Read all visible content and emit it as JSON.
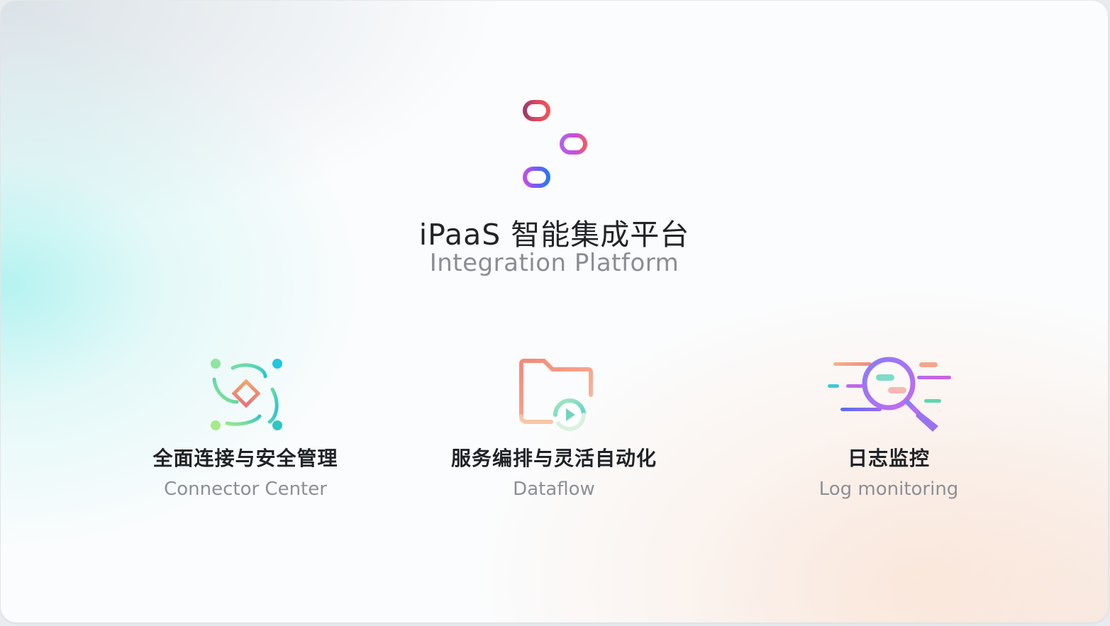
{
  "hero": {
    "title": "iPaaS 智能集成平台",
    "subtitle": "Integration Platform",
    "icon": "sliders-icon"
  },
  "features": [
    {
      "title": "全面连接与安全管理",
      "subtitle": "Connector Center",
      "icon": "connector-icon"
    },
    {
      "title": "服务编排与灵活自动化",
      "subtitle": "Dataflow",
      "icon": "folder-play-icon"
    },
    {
      "title": "日志监控",
      "subtitle": "Log monitoring",
      "icon": "magnifier-icon"
    }
  ]
}
